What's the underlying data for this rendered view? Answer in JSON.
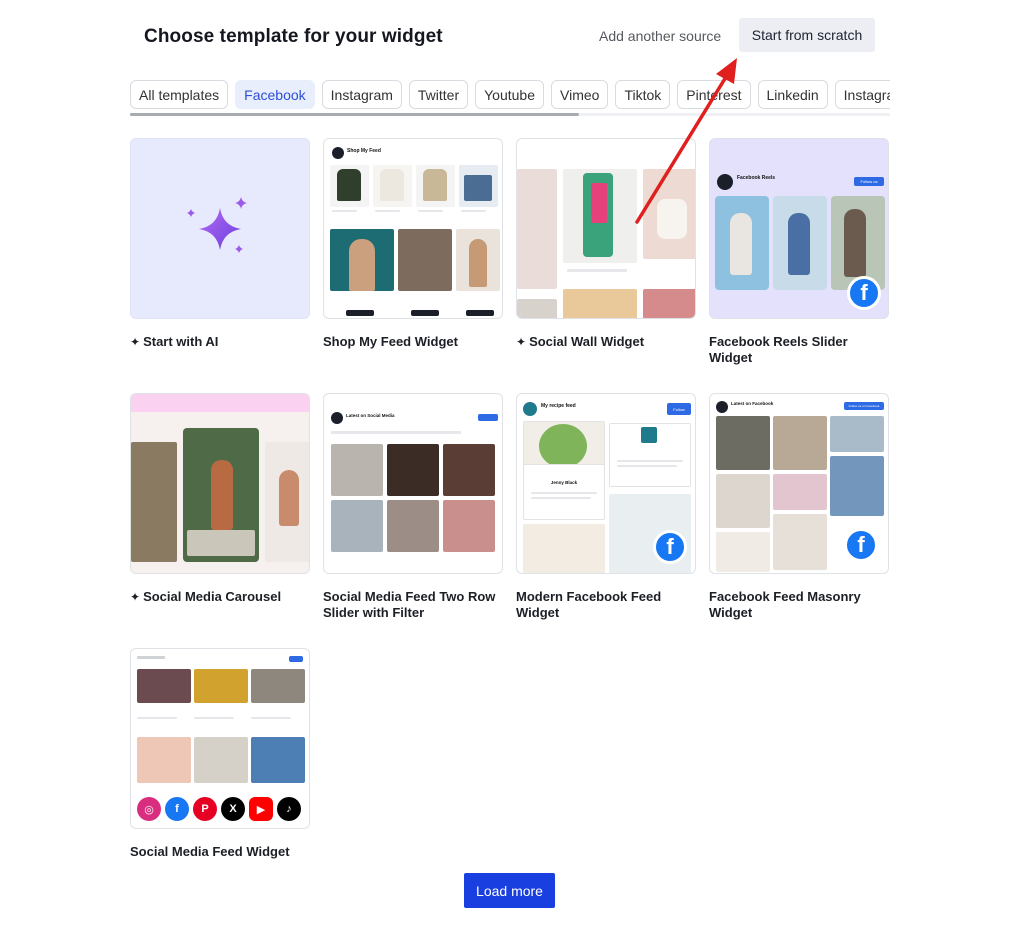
{
  "header": {
    "title": "Choose template for your widget",
    "add_source": "Add another source",
    "start_scratch": "Start from scratch"
  },
  "tabs": [
    {
      "label": "All templates",
      "active": false
    },
    {
      "label": "Facebook",
      "active": true
    },
    {
      "label": "Instagram",
      "active": false
    },
    {
      "label": "Twitter",
      "active": false
    },
    {
      "label": "Youtube",
      "active": false
    },
    {
      "label": "Vimeo",
      "active": false
    },
    {
      "label": "Tiktok",
      "active": false
    },
    {
      "label": "Pinterest",
      "active": false
    },
    {
      "label": "Linkedin",
      "active": false
    },
    {
      "label": "Instagram-s",
      "active": false
    }
  ],
  "templates": [
    {
      "title": "Start with AI",
      "ai": true
    },
    {
      "title": "Shop My Feed Widget",
      "ai": false
    },
    {
      "title": "Social Wall Widget",
      "ai": true
    },
    {
      "title": "Facebook Reels Slider Widget",
      "ai": false
    },
    {
      "title": "Social Media Carousel",
      "ai": true
    },
    {
      "title": "Social Media Feed Two Row Slider with Filter",
      "ai": false
    },
    {
      "title": "Modern Facebook Feed Widget",
      "ai": false
    },
    {
      "title": "Facebook Feed Masonry Widget",
      "ai": false
    },
    {
      "title": "Social Media Feed Widget",
      "ai": false
    }
  ],
  "thumb_text": {
    "shop": "Shop My Feed",
    "reels": "Facebook Reels",
    "reels_follow": "Follow us",
    "twoRow": "Latest on Social Media",
    "recipe": "My recipe feed",
    "recipe_follow": "Follow",
    "recipe_author": "Jenny Black",
    "masonry": "Latest on Facebook",
    "masonry_follow": "Follow us on Facebook"
  },
  "load_more": "Load more",
  "colors": {
    "accent": "#1a3fe0",
    "active_tab_bg": "#e8eefc",
    "facebook": "#1877f2",
    "arrow": "#e01f1f"
  }
}
